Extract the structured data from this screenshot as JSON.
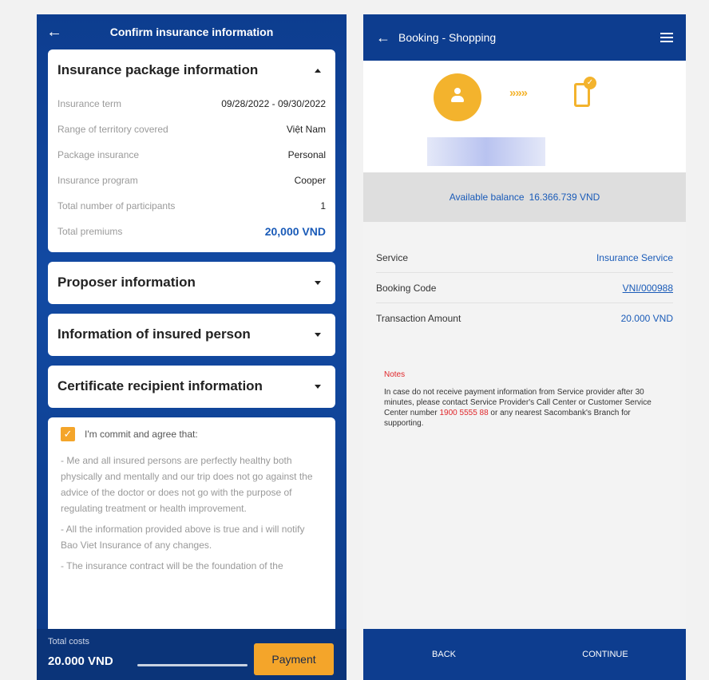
{
  "left": {
    "header": {
      "back_icon": "←",
      "title": "Confirm insurance information"
    },
    "package": {
      "title": "Insurance package information",
      "rows": [
        {
          "key": "Insurance term",
          "value": "09/28/2022 - 09/30/2022"
        },
        {
          "key": "Range of territory covered",
          "value": "Việt Nam"
        },
        {
          "key": "Package insurance",
          "value": "Personal"
        },
        {
          "key": "Insurance program",
          "value": "Cooper"
        },
        {
          "key": "Total number of participants",
          "value": "1"
        },
        {
          "key": "Total premiums",
          "value": "20,000 VND"
        }
      ]
    },
    "sections": [
      "Proposer information",
      "Information of insured person",
      "Certificate recipient information"
    ],
    "commit": {
      "check_glyph": "✓",
      "label": "I'm commit and agree that:",
      "paragraphs": [
        "- Me and all insured persons are perfectly healthy both physically and mentally and our trip does not go against the advice of the doctor or does not go with the purpose of regulating treatment or health improvement.",
        "- All the information provided above is true and i will notify Bao Viet Insurance of any changes.",
        "- The insurance contract will be the foundation of the"
      ]
    },
    "footer": {
      "label": "Total costs",
      "amount": "20.000 VND",
      "pay_button": "Payment"
    }
  },
  "right": {
    "header": {
      "back_icon": "←",
      "title": "Booking - Shopping"
    },
    "hero": {
      "arrows": "»»»",
      "check_glyph": "✓"
    },
    "balance": {
      "label": "Available balance",
      "amount": "16.366.739 VND"
    },
    "details": [
      {
        "key": "Service",
        "value": "Insurance Service"
      },
      {
        "key": "Booking Code",
        "value": "VNI/000988"
      },
      {
        "key": "Transaction Amount",
        "value": "20.000 VND"
      }
    ],
    "notes": {
      "title": "Notes",
      "text_1": "In case do not receive payment information from Service provider after 30 minutes, please contact Service Provider's Call Center or Customer Service Center number ",
      "phone": "1900 5555 88",
      "text_2": " or any nearest Sacombank's Branch for supporting."
    },
    "footer": {
      "back": "BACK",
      "continue": "CONTINUE"
    }
  },
  "colors": {
    "brand_blue": "#0d3d8f",
    "accent_orange": "#f4a52a",
    "link_blue": "#1a5bb8",
    "alert_red": "#e0262a"
  }
}
